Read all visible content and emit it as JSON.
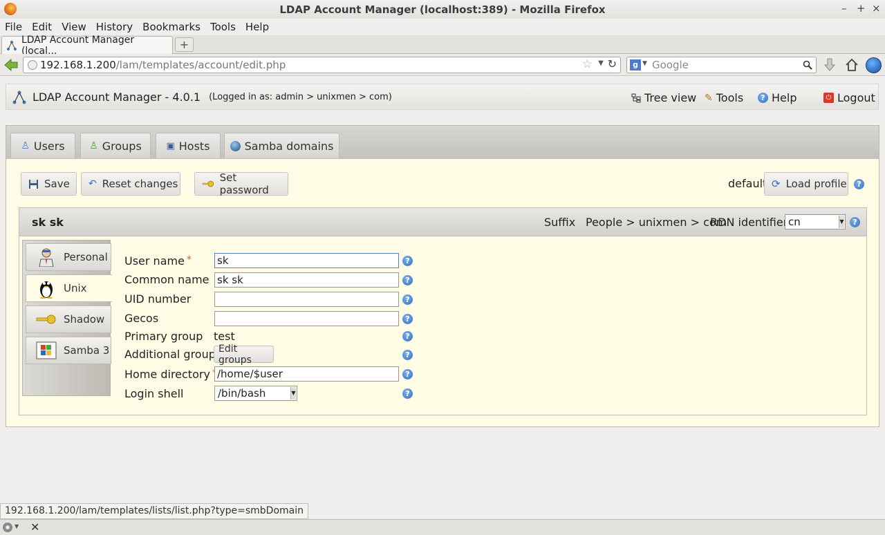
{
  "window": {
    "title": "LDAP Account Manager (localhost:389) - Mozilla Firefox"
  },
  "menu": [
    "File",
    "Edit",
    "View",
    "History",
    "Bookmarks",
    "Tools",
    "Help"
  ],
  "browser": {
    "tab_label": "LDAP Account Manager (local...",
    "new_tab": "+",
    "url_host": "192.168.1.200",
    "url_path": "/lam/templates/account/edit.php",
    "search_placeholder": "Google"
  },
  "header": {
    "title": "LDAP Account Manager - 4.0.1",
    "logged_in": "(Logged in as: admin > unixmen > com)",
    "links": {
      "tree_view": "Tree view",
      "tools": "Tools",
      "help": "Help",
      "logout": "Logout"
    }
  },
  "type_tabs": [
    "Users",
    "Groups",
    "Hosts",
    "Samba domains"
  ],
  "toolbar": {
    "save": "Save",
    "reset": "Reset changes",
    "set_password": "Set password",
    "profile_value": "default",
    "load_profile": "Load profile"
  },
  "account": {
    "name": "sk sk",
    "suffix_label": "Suffix",
    "suffix_value": "People > unixmen > com",
    "rdn_label": "RDN identifier",
    "rdn_value": "cn"
  },
  "side_tabs": [
    "Personal",
    "Unix",
    "Shadow",
    "Samba 3"
  ],
  "active_side_tab": "Unix",
  "form": {
    "user_name_label": "User name",
    "user_name_value": "sk",
    "common_name_label": "Common name",
    "common_name_value": "sk sk",
    "uid_label": "UID number",
    "uid_value": "",
    "gecos_label": "Gecos",
    "gecos_value": "",
    "primary_group_label": "Primary group",
    "primary_group_value": "test",
    "additional_groups_label": "Additional groups",
    "edit_groups": "Edit groups",
    "home_label": "Home directory",
    "home_value": "/home/$user",
    "shell_label": "Login shell",
    "shell_value": "/bin/bash",
    "required_mark": "*"
  },
  "status_url": "192.168.1.200/lam/templates/lists/list.php?type=smbDomain"
}
